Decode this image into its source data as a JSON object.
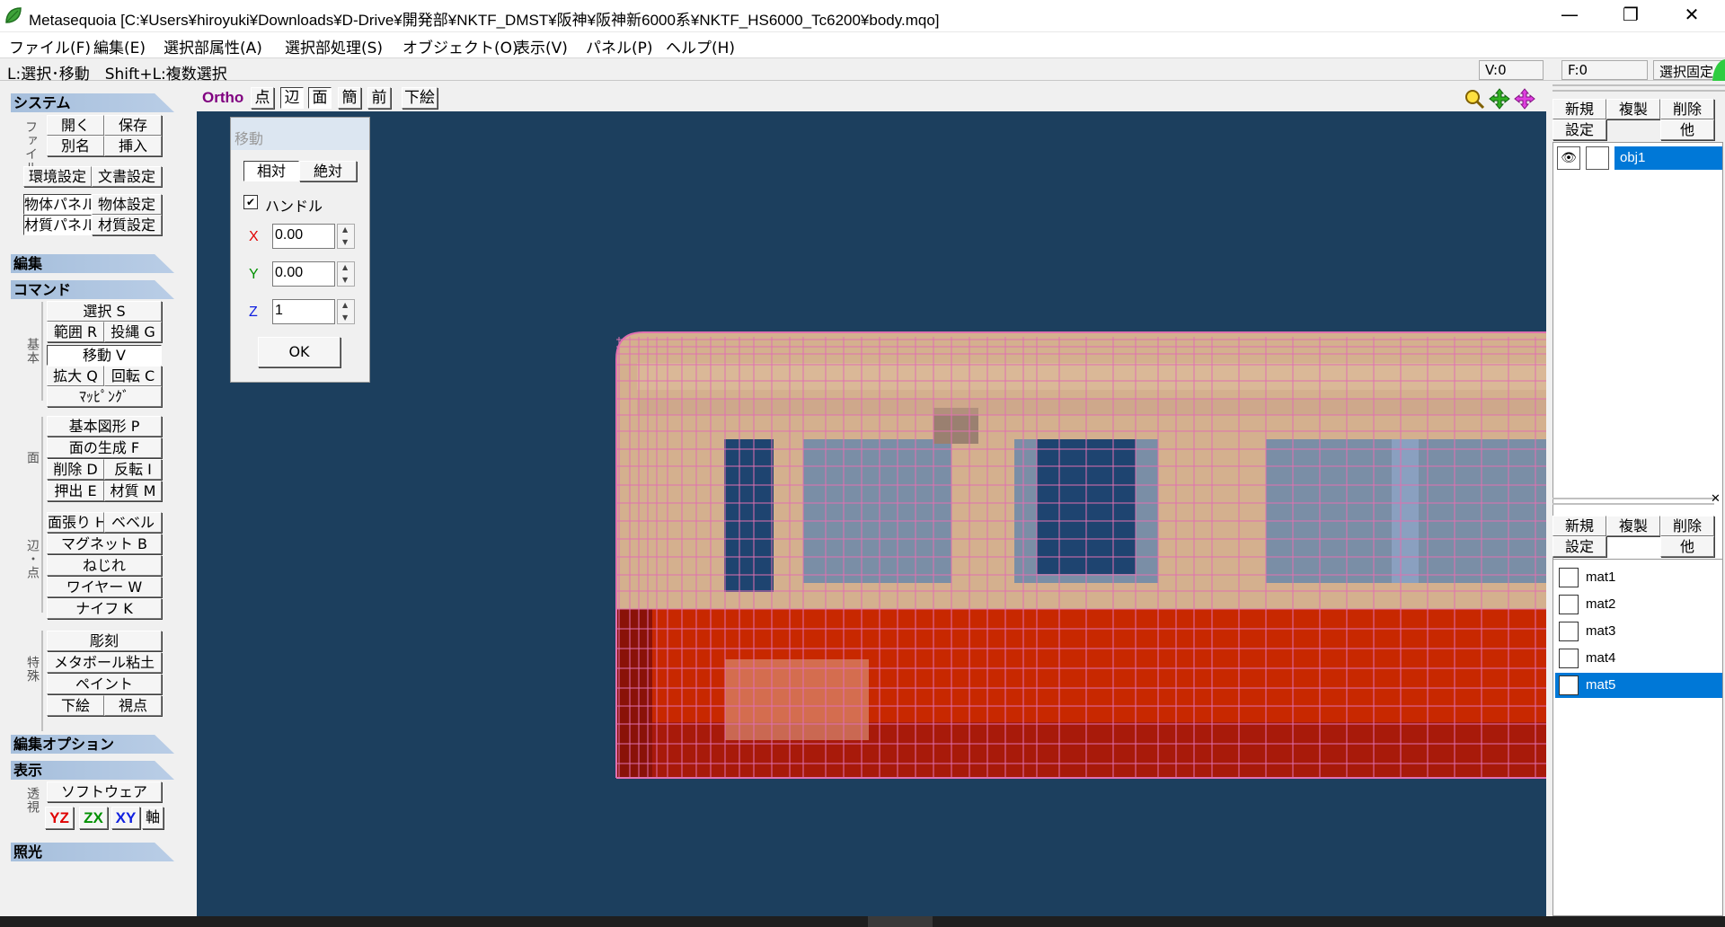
{
  "window": {
    "title": "Metasequoia [C:¥Users¥hiroyuki¥Downloads¥D-Drive¥開発部¥NKTF_DMST¥阪神¥阪神新6000系¥NKTF_HS6000_Tc6200¥body.mqo]",
    "minimize_glyph": "—",
    "maximize_glyph": "❐",
    "close_glyph": "✕"
  },
  "menu": [
    "ファイル(F)",
    "編集(E)",
    "選択部属性(A)",
    "選択部処理(S)",
    "オブジェクト(O)",
    "表示(V)",
    "パネル(P)",
    "ヘルプ(H)"
  ],
  "status": {
    "hint": "L:選択･移動　Shift+L:複数選択",
    "vertex_count": "V:0",
    "face_count": "F:0",
    "select_lock": "選択固定"
  },
  "left": {
    "system": {
      "header": "システム",
      "file_label": "ファイル",
      "open": "開く",
      "save": "保存",
      "save_as": "別名",
      "insert": "挿入",
      "env_settings": "環境設定",
      "doc_settings": "文書設定",
      "obj_panel": "物体パネル",
      "obj_settings": "物体設定",
      "mat_panel": "材質パネル",
      "mat_settings": "材質設定"
    },
    "edit": {
      "header": "編集"
    },
    "command": {
      "header": "コマンド",
      "basic_label": "基本",
      "select": "選択 S",
      "range": "範囲 R",
      "lasso": "投縄 G",
      "move": "移動 V",
      "scale": "拡大 Q",
      "rotate": "回転 C",
      "mapping": "ﾏｯﾋﾟﾝｸﾞ",
      "face_label": "面",
      "primitive": "基本図形 P",
      "face_gen": "面の生成 F",
      "delete": "削除 D",
      "flip": "反転 I",
      "extrude": "押出 E",
      "material": "材質 M",
      "edge_label": "辺・点",
      "face_stretch": "面張り H",
      "bevel": "ベベル",
      "magnet": "マグネット B",
      "twist": "ねじれ",
      "wire": "ワイヤー W",
      "knife": "ナイフ K",
      "special_label": "特殊",
      "sculpt": "彫刻",
      "metaball": "メタボール粘土",
      "paint": "ペイント",
      "underlay": "下絵",
      "viewpoint": "視点"
    },
    "edit_options": {
      "header": "編集オプション"
    },
    "display": {
      "header": "表示",
      "persp_label": "透視",
      "software": "ソフトウェア",
      "yz": "YZ",
      "zx": "ZX",
      "xy": "XY",
      "axis": "軸"
    },
    "lighting": {
      "header": "照光"
    }
  },
  "viewtoolbar": {
    "ortho": "Ortho",
    "point": "点",
    "edge": "辺",
    "face": "面",
    "simple": "簡",
    "front": "前",
    "underlay": "下絵"
  },
  "move_panel": {
    "title": "移動",
    "relative": "相対",
    "absolute": "絶対",
    "handle_check": "✔",
    "handle": "ハンドル",
    "x_label": "X",
    "x_value": "0.00",
    "y_label": "Y",
    "y_value": "0.00",
    "z_label": "Z",
    "z_value": "1",
    "ok": "OK"
  },
  "object_panel": {
    "new": "新規",
    "copy": "複製",
    "delete": "削除",
    "settings": "設定",
    "other": "他",
    "objects": [
      {
        "name": "obj1"
      }
    ]
  },
  "material_panel": {
    "close_glyph": "✕",
    "new": "新規",
    "copy": "複製",
    "delete": "削除",
    "settings": "設定",
    "other": "他",
    "materials": [
      {
        "name": "mat1"
      },
      {
        "name": "mat2"
      },
      {
        "name": "mat3"
      },
      {
        "name": "mat4"
      },
      {
        "name": "mat5"
      }
    ]
  },
  "colors": {
    "viewport_bg": "#1c3f5e",
    "wire": "#e070b0",
    "body_tan": "#d4b08e",
    "window_blue": "#1e4470",
    "window_gray": "#7a8ea6",
    "red_band": "#c82800",
    "dark_red": "#a81a0a",
    "selection": "#0078d7"
  }
}
